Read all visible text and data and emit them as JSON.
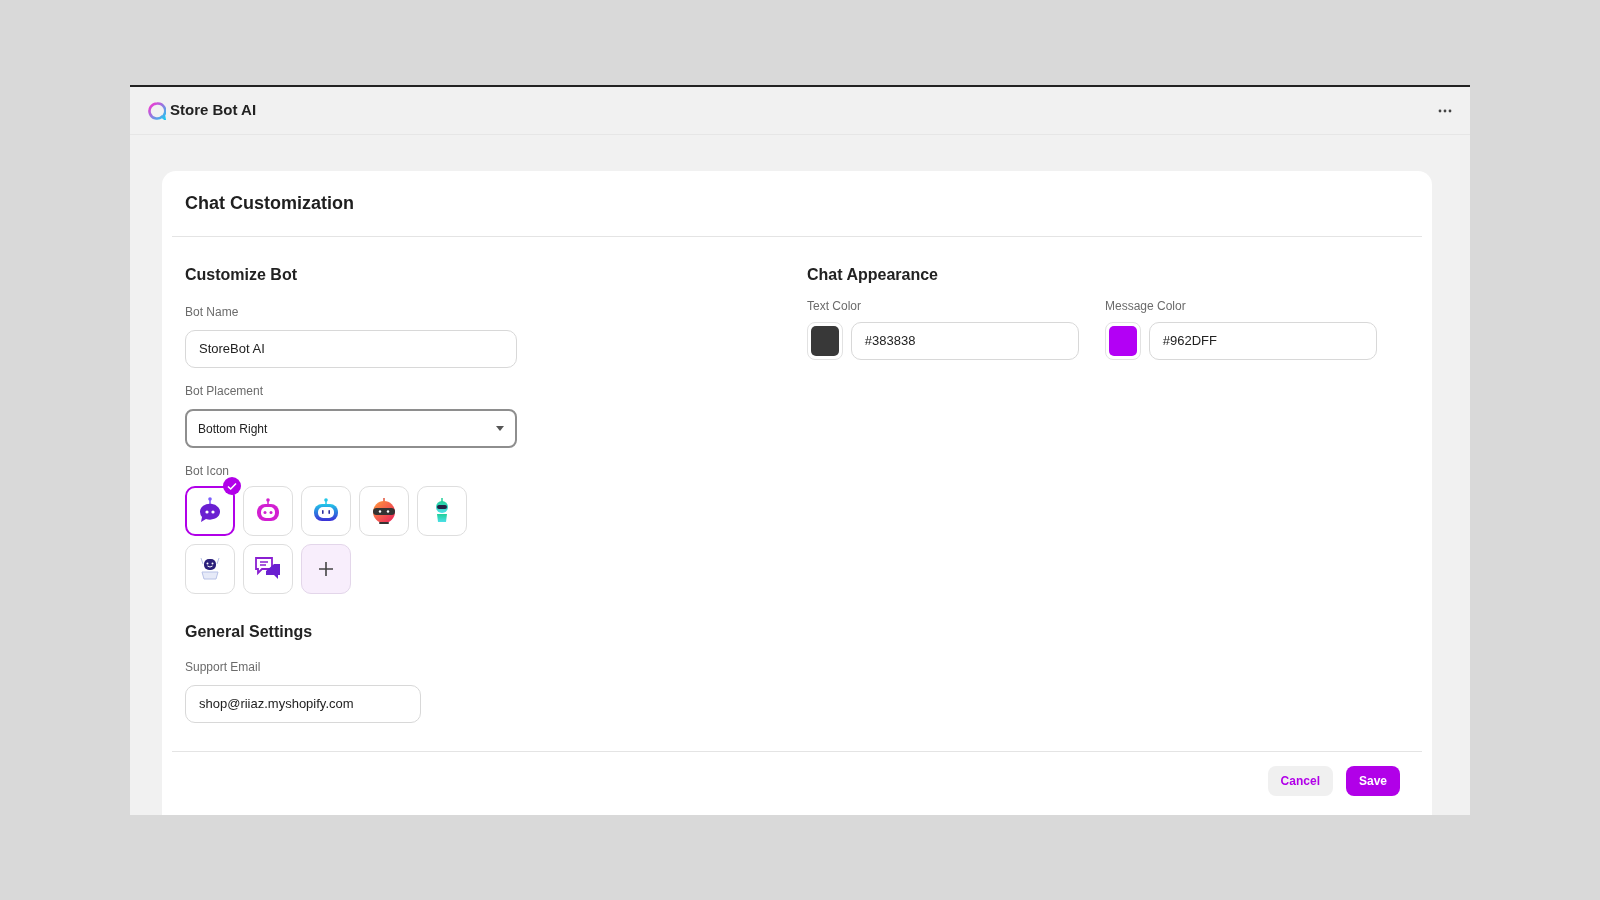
{
  "app": {
    "title": "Store Bot AI"
  },
  "page": {
    "title": "Chat Customization"
  },
  "customize_bot": {
    "heading": "Customize Bot",
    "bot_name": {
      "label": "Bot Name",
      "value": "StoreBot AI"
    },
    "bot_placement": {
      "label": "Bot Placement",
      "value": "Bottom Right"
    },
    "bot_icon": {
      "label": "Bot Icon",
      "options": [
        {
          "kind": "bubble",
          "selected": true
        },
        {
          "kind": "pink",
          "selected": false
        },
        {
          "kind": "blue",
          "selected": false
        },
        {
          "kind": "red",
          "selected": false
        },
        {
          "kind": "green",
          "selected": false
        },
        {
          "kind": "navy",
          "selected": false
        },
        {
          "kind": "chat",
          "selected": false
        }
      ]
    }
  },
  "general_settings": {
    "heading": "General Settings",
    "support_email": {
      "label": "Support Email",
      "value": "shop@riiaz.myshopify.com"
    }
  },
  "chat_appearance": {
    "heading": "Chat Appearance",
    "colors": [
      {
        "label": "Text Color",
        "value": "#383838",
        "color": "#383838"
      },
      {
        "label": "Message Color",
        "value": "#962DFF",
        "color": "#b300f5"
      }
    ]
  },
  "buttons": [
    {
      "label": "Cancel",
      "kind": "secondary"
    },
    {
      "label": "Save",
      "kind": "primary"
    }
  ]
}
